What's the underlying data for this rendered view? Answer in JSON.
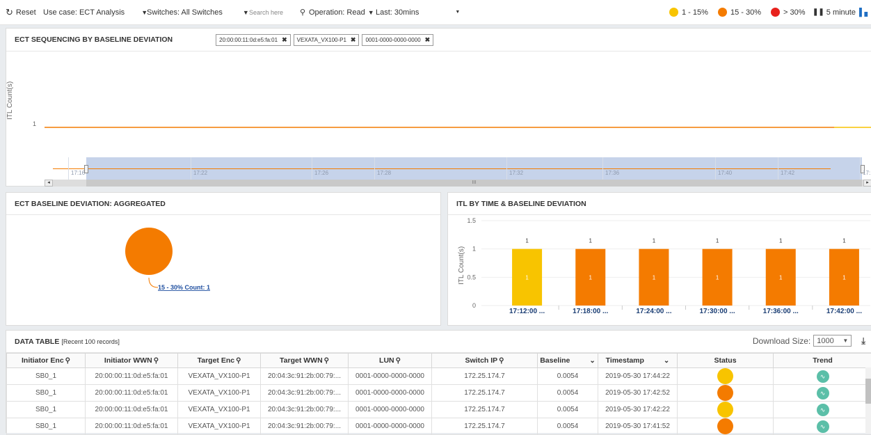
{
  "toolbar": {
    "reset_label": "Reset",
    "use_case": "Use case: ECT Analysis",
    "switches": "Switches: All Switches",
    "search_placeholder": "Search here",
    "operation": "Operation: Read",
    "last": "Last: 30mins",
    "legend": [
      {
        "label": "1 - 15%",
        "color": "#f8c400"
      },
      {
        "label": "15 - 30%",
        "color": "#f47b00"
      },
      {
        "label": "> 30%",
        "color": "#e8211d"
      }
    ],
    "interval": "5 minute"
  },
  "sequencing": {
    "title": "ECT SEQUENCING BY BASELINE DEVIATION",
    "chips": [
      "20:00:00:11:0d:e5:fa:01",
      "VEXATA_VX100-P1",
      "0001-0000-0000-0000"
    ],
    "ylabel": "ITL Count(s)",
    "ytick": "1",
    "xticks": [
      "17:19",
      "17:22",
      "17:25",
      "17:27",
      "17:28",
      "17:31",
      "17:34",
      "17:36",
      "17:39",
      "17:41",
      "17:42",
      "17:44"
    ],
    "nav_ticks": [
      "17:16",
      "17:22",
      "17:26",
      "17:28",
      "17:32",
      "17:36",
      "17:40",
      "17:42",
      "17:..."
    ],
    "scroll_grip": "III"
  },
  "aggregated": {
    "title": "ECT BASELINE DEVIATION: AGGREGATED",
    "bubble_label": "15 - 30% Count: 1",
    "color": "#f47b00"
  },
  "itl": {
    "title": "ITL BY TIME & BASELINE DEVIATION"
  },
  "chart_data": {
    "type": "bar",
    "categories": [
      "17:12:00 ...",
      "17:18:00 ...",
      "17:24:00 ...",
      "17:30:00 ...",
      "17:36:00 ...",
      "17:42:00 ..."
    ],
    "values": [
      1,
      1,
      1,
      1,
      1,
      1
    ],
    "colors": [
      "#f8c400",
      "#f47b00",
      "#f47b00",
      "#f47b00",
      "#f47b00",
      "#f47b00"
    ],
    "ylabel": "ITL Count(s)",
    "yticks": [
      "0",
      "0.5",
      "1",
      "1.5"
    ],
    "ylim": [
      0,
      1.5
    ],
    "data_labels": [
      "1",
      "1",
      "1",
      "1",
      "1",
      "1"
    ],
    "inner_labels": [
      "1",
      "1",
      "1",
      "1",
      "1",
      "1"
    ]
  },
  "table": {
    "title": "DATA TABLE",
    "subtitle": "[Recent 100 records]",
    "download_label": "Download Size:",
    "download_value": "1000",
    "columns": [
      "Initiator Enc",
      "Initiator WWN",
      "Target Enc",
      "Target WWN",
      "LUN",
      "Switch IP",
      "Baseline",
      "Timestamp",
      "Status",
      "Trend"
    ],
    "rows": [
      {
        "cells": [
          "SB0_1",
          "20:00:00:11:0d:e5:fa:01",
          "VEXATA_VX100-P1",
          "20:04:3c:91:2b:00:79:...",
          "0001-0000-0000-0000",
          "172.25.174.7",
          "0.0054",
          "2019-05-30 17:44:22"
        ],
        "status": "#f8c400"
      },
      {
        "cells": [
          "SB0_1",
          "20:00:00:11:0d:e5:fa:01",
          "VEXATA_VX100-P1",
          "20:04:3c:91:2b:00:79:...",
          "0001-0000-0000-0000",
          "172.25.174.7",
          "0.0054",
          "2019-05-30 17:42:52"
        ],
        "status": "#f47b00"
      },
      {
        "cells": [
          "SB0_1",
          "20:00:00:11:0d:e5:fa:01",
          "VEXATA_VX100-P1",
          "20:04:3c:91:2b:00:79:...",
          "0001-0000-0000-0000",
          "172.25.174.7",
          "0.0054",
          "2019-05-30 17:42:22"
        ],
        "status": "#f8c400"
      },
      {
        "cells": [
          "SB0_1",
          "20:00:00:11:0d:e5:fa:01",
          "VEXATA_VX100-P1",
          "20:04:3c:91:2b:00:79:...",
          "0001-0000-0000-0000",
          "172.25.174.7",
          "0.0054",
          "2019-05-30 17:41:52"
        ],
        "status": "#f47b00"
      }
    ]
  }
}
